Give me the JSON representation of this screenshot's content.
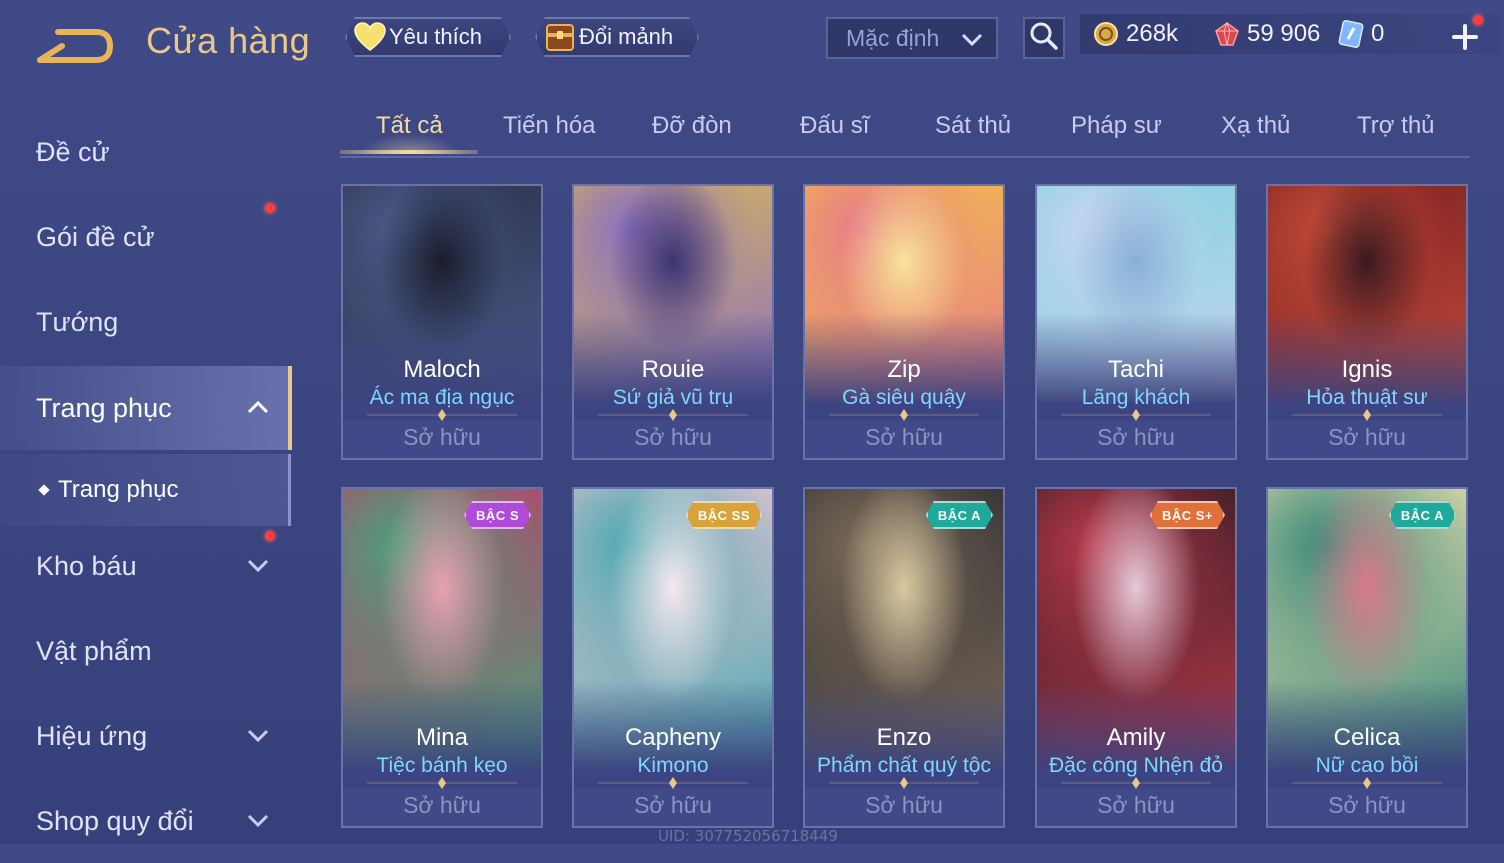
{
  "header": {
    "title": "Cửa hàng",
    "favorite_label": "Yêu thích",
    "shard_label": "Đổi mảnh",
    "sort_selected": "Mặc định"
  },
  "currencies": {
    "gold": "268k",
    "ruby": "59 906",
    "voucher": "0"
  },
  "sidebar": {
    "items": [
      {
        "label": "Đề cử"
      },
      {
        "label": "Gói đề cử"
      },
      {
        "label": "Tướng"
      },
      {
        "label": "Trang phục"
      },
      {
        "label": "Kho báu"
      },
      {
        "label": "Vật phẩm"
      },
      {
        "label": "Hiệu ứng"
      },
      {
        "label": "Shop quy đổi"
      }
    ],
    "sub_item": "Trang phục"
  },
  "tabs": [
    "Tất cả",
    "Tiến hóa",
    "Đỡ đòn",
    "Đấu sĩ",
    "Sát thủ",
    "Pháp sư",
    "Xạ thủ",
    "Trợ thủ"
  ],
  "cards": [
    {
      "hero": "Maloch",
      "skin": "Ác ma địa ngục",
      "status": "Sở hữu",
      "tier": ""
    },
    {
      "hero": "Rouie",
      "skin": "Sứ giả vũ trụ",
      "status": "Sở hữu",
      "tier": ""
    },
    {
      "hero": "Zip",
      "skin": "Gà siêu quậy",
      "status": "Sở hữu",
      "tier": ""
    },
    {
      "hero": "Tachi",
      "skin": "Lãng khách",
      "status": "Sở hữu",
      "tier": ""
    },
    {
      "hero": "Ignis",
      "skin": "Hỏa thuật sư",
      "status": "Sở hữu",
      "tier": ""
    },
    {
      "hero": "Mina",
      "skin": "Tiệc bánh kẹo",
      "status": "Sở hữu",
      "tier": "BẬC S"
    },
    {
      "hero": "Capheny",
      "skin": "Kimono",
      "status": "Sở hữu",
      "tier": "BẬC SS"
    },
    {
      "hero": "Enzo",
      "skin": "Phẩm chất quý tộc",
      "status": "Sở hữu",
      "tier": "BẬC A"
    },
    {
      "hero": "Amily",
      "skin": "Đặc công Nhện đỏ",
      "status": "Sở hữu",
      "tier": "BẬC S+"
    },
    {
      "hero": "Celica",
      "skin": "Nữ cao bồi",
      "status": "Sở hữu",
      "tier": "BẬC A"
    }
  ],
  "footer": {
    "uid": "UID: 307752056718449"
  },
  "colors": {
    "accent_gold": "#e8c98a",
    "skin_name": "#7fd6ff",
    "notification": "#ff3b3b",
    "tier_s": "#b04ad8",
    "tier_ss": "#d9a23a",
    "tier_a": "#1fa99a",
    "tier_splus": "#e0703a"
  }
}
